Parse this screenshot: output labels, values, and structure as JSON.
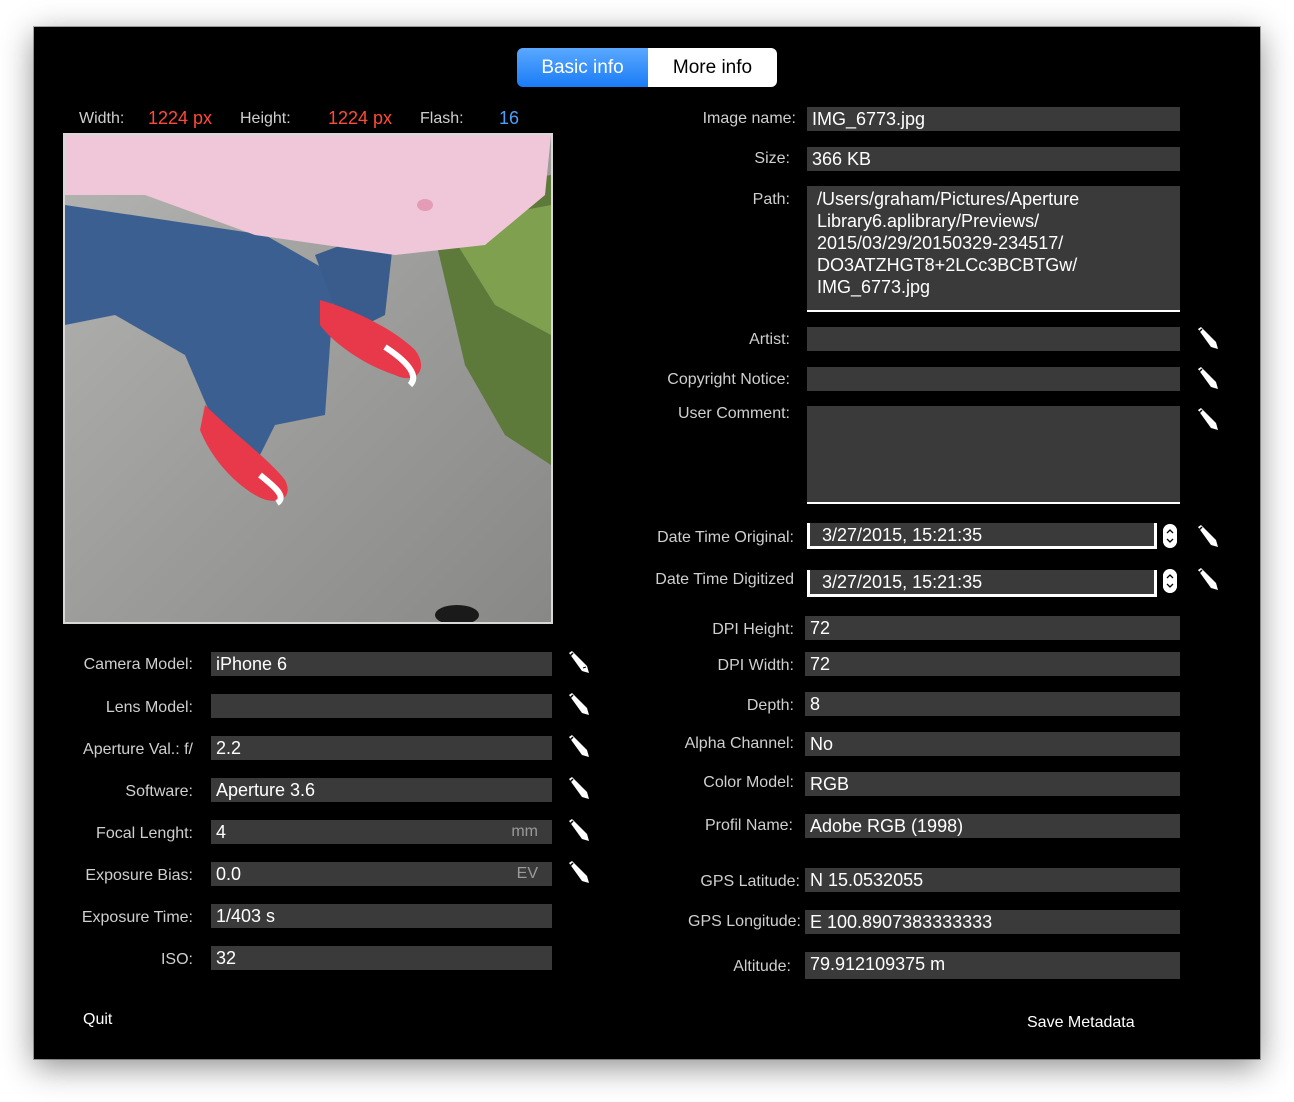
{
  "tabs": {
    "basic": "Basic info",
    "more": "More info"
  },
  "image_stats": {
    "width_label": "Width:",
    "width_value": "1224 px",
    "height_label": "Height:",
    "height_value": "1224 px",
    "flash_label": "Flash:",
    "flash_value": "16"
  },
  "left_fields": {
    "camera_model": {
      "label": "Camera Model:",
      "value": "iPhone 6"
    },
    "lens_model": {
      "label": "Lens Model:",
      "value": ""
    },
    "aperture": {
      "label": "Aperture Val.: f/",
      "value": "2.2"
    },
    "software": {
      "label": "Software:",
      "value": "Aperture 3.6"
    },
    "focal_length": {
      "label": "Focal Lenght:",
      "value": "4",
      "unit": "mm"
    },
    "exposure_bias": {
      "label": "Exposure Bias:",
      "value": "0.0",
      "unit": "EV"
    },
    "exposure_time": {
      "label": "Exposure Time:",
      "value": "1/403 s"
    },
    "iso": {
      "label": "ISO:",
      "value": "32"
    }
  },
  "right_fields": {
    "image_name": {
      "label": "Image name:",
      "value": "IMG_6773.jpg"
    },
    "size": {
      "label": "Size:",
      "value": "366 KB"
    },
    "path": {
      "label": "Path:",
      "value": "/Users/graham/Pictures/Aperture\nLibrary6.aplibrary/Previews/\n2015/03/29/20150329-234517/\nDO3ATZHGT8+2LCc3BCBTGw/\nIMG_6773.jpg"
    },
    "artist": {
      "label": "Artist:",
      "value": ""
    },
    "copyright": {
      "label": "Copyright Notice:",
      "value": ""
    },
    "user_comment": {
      "label": "User Comment:",
      "value": ""
    },
    "date_original": {
      "label": "Date Time Original:",
      "value": "3/27/2015, 15:21:35"
    },
    "date_digitized": {
      "label": "Date Time Digitized",
      "value": "3/27/2015, 15:21:35"
    },
    "dpi_height": {
      "label": "DPI Height:",
      "value": "72"
    },
    "dpi_width": {
      "label": "DPI Width:",
      "value": "72"
    },
    "depth": {
      "label": "Depth:",
      "value": "8"
    },
    "alpha": {
      "label": "Alpha Channel:",
      "value": "No"
    },
    "color_model": {
      "label": "Color Model:",
      "value": "RGB"
    },
    "profile_name": {
      "label": "Profil Name:",
      "value": "Adobe RGB (1998)"
    },
    "gps_lat": {
      "label": "GPS Latitude:",
      "value": "N 15.0532055"
    },
    "gps_lon": {
      "label": "GPS Longitude:",
      "value": "E 100.8907383333333"
    },
    "altitude": {
      "label": "Altitude:",
      "value": "79.912109375 m"
    }
  },
  "buttons": {
    "quit": "Quit",
    "save": "Save Metadata"
  },
  "icons": {
    "edit": "pencil-icon",
    "stepper": "stepper-icon"
  },
  "colors": {
    "accent": "#1a7cf6",
    "dimension_value": "#ff4a3a",
    "flash_value": "#4aa0ff",
    "field_bg": "#3a3a3a",
    "window_bg": "#000000"
  }
}
